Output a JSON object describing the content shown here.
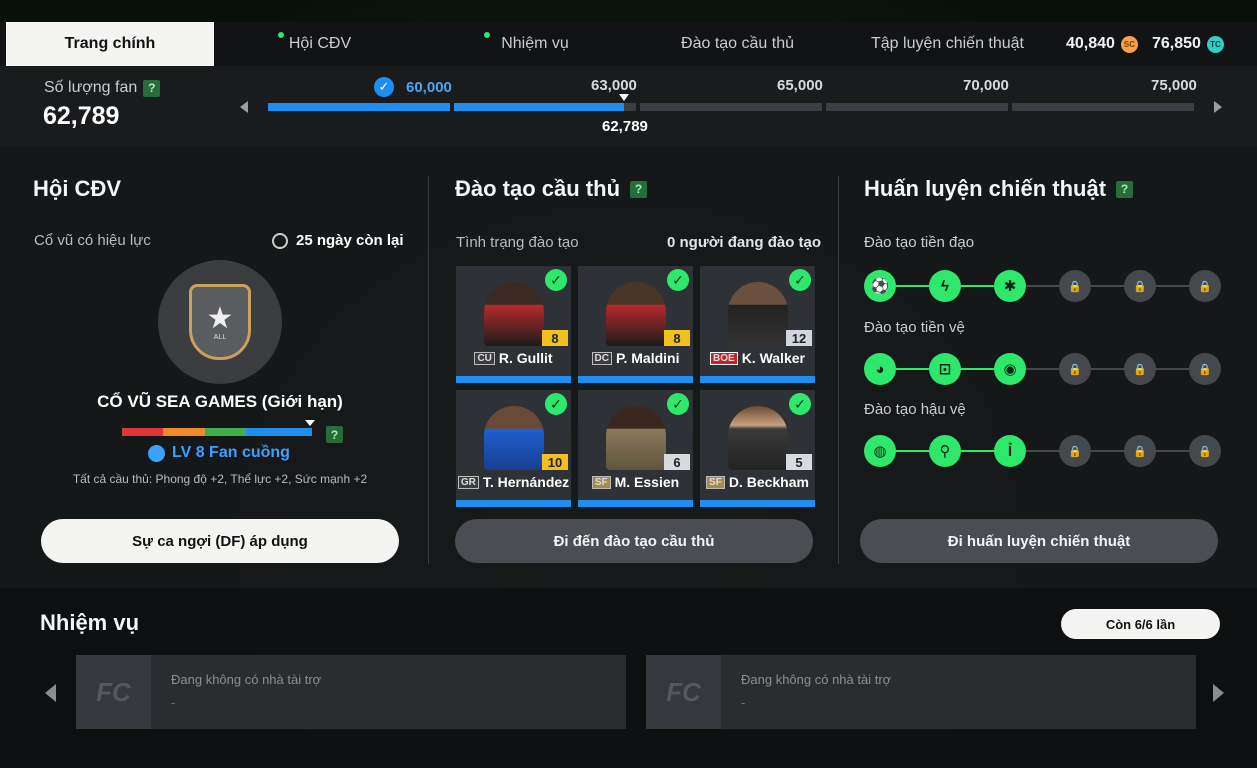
{
  "nav": {
    "tabs": [
      {
        "label": "Trang chính",
        "active": true,
        "dot": false
      },
      {
        "label": "Hội CĐV",
        "active": false,
        "dot": true
      },
      {
        "label": "Nhiệm vụ",
        "active": false,
        "dot": true
      },
      {
        "label": "Đào tạo cầu thủ",
        "active": false,
        "dot": false
      },
      {
        "label": "Tập luyện chiến thuật",
        "active": false,
        "dot": false
      }
    ],
    "currency_sc": "40,840",
    "currency_tc": "76,850",
    "sc_icon": "sc-coin-icon",
    "tc_icon": "tc-coin-icon"
  },
  "fan": {
    "label": "Số lượng fan",
    "help": "?",
    "value": "62,789",
    "milestones": [
      "60,000",
      "63,000",
      "65,000",
      "70,000",
      "75,000"
    ],
    "current_marker": "62,789",
    "progress_fraction": 0.26
  },
  "club": {
    "title": "Hội CĐV",
    "cheer_label": "Cổ vũ có hiệu lực",
    "days_left": "25 ngày còn lại",
    "badge_text": "ALL",
    "cheer_name": "CỔ VŨ SEA GAMES (Giới hạn)",
    "level": "LV 8 Fan cuồng",
    "bonus": "Tất cả cầu thủ: Phong độ +2, Thể lực +2, Sức mạnh +2",
    "button": "Sự ca ngợi (DF) áp dụng",
    "level_colors": [
      "#e0353b",
      "#f08a2c",
      "#3fae4a",
      "#1e8ff0"
    ]
  },
  "training": {
    "title": "Đào tạo cầu thủ",
    "help": "?",
    "status_label": "Tình trạng đào tạo",
    "status_value": "0 người đang đào tạo",
    "players": [
      {
        "pos": "CU",
        "name": "R. Gullit",
        "level": "8",
        "level_color": "#f2c01e"
      },
      {
        "pos": "DC",
        "name": "P. Maldini",
        "level": "8",
        "level_color": "#f2c01e"
      },
      {
        "pos": "BOE",
        "name": "K. Walker",
        "level": "12",
        "level_color": "#cfd6e0"
      },
      {
        "pos": "GR",
        "name": "T. Hernández",
        "level": "10",
        "level_color": "#f2c01e"
      },
      {
        "pos": "SF",
        "name": "M. Essien",
        "level": "6",
        "level_color": "#d8dadd"
      },
      {
        "pos": "SF",
        "name": "D. Beckham",
        "level": "5",
        "level_color": "#d8dadd"
      }
    ],
    "button": "Đi đến đào tạo cầu thủ"
  },
  "tactics": {
    "title": "Huấn luyện chiến thuật",
    "help": "?",
    "rows": [
      {
        "label": "Đào tạo tiền đạo",
        "unlocked": 3,
        "total": 6
      },
      {
        "label": "Đào tạo tiền vệ",
        "unlocked": 3,
        "total": 6
      },
      {
        "label": "Đào tạo hậu vệ",
        "unlocked": 3,
        "total": 6
      }
    ],
    "button": "Đi huấn luyện chiến thuật"
  },
  "missions": {
    "title": "Nhiệm vụ",
    "remaining": "Còn 6/6 lần",
    "cards": [
      {
        "logo": "FC",
        "title": "Đang không có nhà tài trợ",
        "sub": "-"
      },
      {
        "logo": "FC",
        "title": "Đang không có nhà tài trợ",
        "sub": "-"
      }
    ]
  }
}
